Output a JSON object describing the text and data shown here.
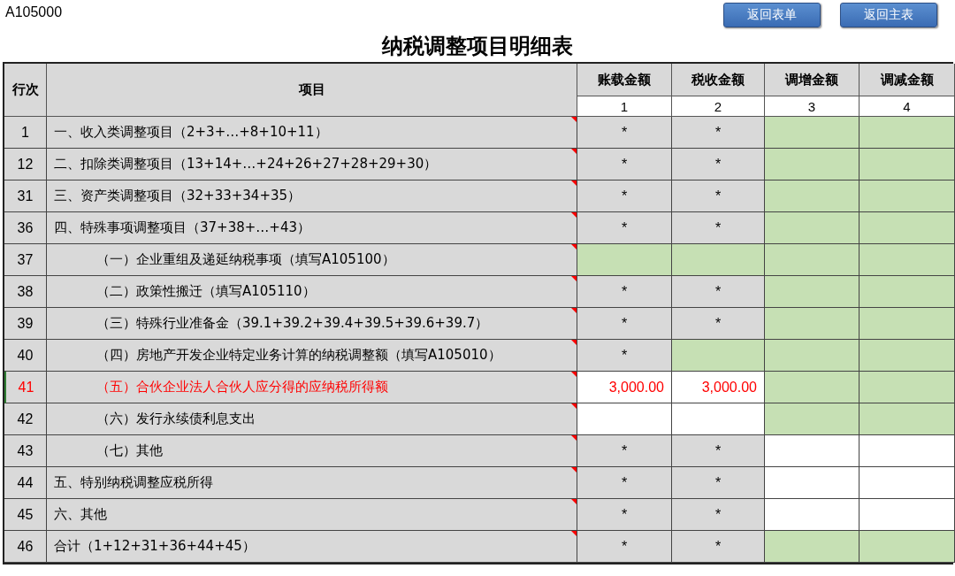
{
  "form_code": "A105000",
  "buttons": [
    {
      "label": "返回表单"
    },
    {
      "label": "返回主表"
    }
  ],
  "title": "纳税调整项目明细表",
  "columns": [
    {
      "label": "行次"
    },
    {
      "label": "项目"
    },
    {
      "label": "账载金额",
      "number": "1"
    },
    {
      "label": "税收金额",
      "number": "2"
    },
    {
      "label": "调增金额",
      "number": "3"
    },
    {
      "label": "调减金额",
      "number": "4"
    }
  ],
  "rows": [
    {
      "no": "1",
      "item": "一、收入类调整项目（2+3+…+8+10+11）",
      "highlighted": false,
      "cells": [
        {
          "kind": "locked",
          "text": "*"
        },
        {
          "kind": "locked",
          "text": "*"
        },
        {
          "kind": "input"
        },
        {
          "kind": "input"
        }
      ]
    },
    {
      "no": "12",
      "item": "二、扣除类调整项目（13+14+…+24+26+27+28+29+30）",
      "highlighted": false,
      "cells": [
        {
          "kind": "locked",
          "text": "*"
        },
        {
          "kind": "locked",
          "text": "*"
        },
        {
          "kind": "input"
        },
        {
          "kind": "input"
        }
      ]
    },
    {
      "no": "31",
      "item": "三、资产类调整项目（32+33+34+35）",
      "highlighted": false,
      "cells": [
        {
          "kind": "locked",
          "text": "*"
        },
        {
          "kind": "locked",
          "text": "*"
        },
        {
          "kind": "input"
        },
        {
          "kind": "input"
        }
      ]
    },
    {
      "no": "36",
      "item": "四、特殊事项调整项目（37+38+…+43）",
      "highlighted": false,
      "cells": [
        {
          "kind": "locked",
          "text": "*"
        },
        {
          "kind": "locked",
          "text": "*"
        },
        {
          "kind": "input"
        },
        {
          "kind": "input"
        }
      ],
      "children": [
        {
          "no": "37",
          "item": "（一）企业重组及递延纳税事项（填写A105100）",
          "highlighted": false,
          "cells": [
            {
              "kind": "input"
            },
            {
              "kind": "input"
            },
            {
              "kind": "input"
            },
            {
              "kind": "input"
            }
          ]
        },
        {
          "no": "38",
          "item": "（二）政策性搬迁（填写A105110）",
          "highlighted": false,
          "cells": [
            {
              "kind": "locked",
              "text": "*"
            },
            {
              "kind": "locked",
              "text": "*"
            },
            {
              "kind": "input"
            },
            {
              "kind": "input"
            }
          ]
        },
        {
          "no": "39",
          "item": "（三）特殊行业准备金（39.1+39.2+39.4+39.5+39.6+39.7）",
          "highlighted": false,
          "cells": [
            {
              "kind": "locked",
              "text": "*"
            },
            {
              "kind": "locked",
              "text": "*"
            },
            {
              "kind": "input"
            },
            {
              "kind": "input"
            }
          ]
        },
        {
          "no": "40",
          "item": "（四）房地产开发企业特定业务计算的纳税调整额（填写A105010）",
          "highlighted": false,
          "cells": [
            {
              "kind": "locked",
              "text": "*"
            },
            {
              "kind": "input"
            },
            {
              "kind": "input"
            },
            {
              "kind": "input"
            }
          ]
        },
        {
          "no": "41",
          "item": "（五）合伙企业法人合伙人应分得的应纳税所得额",
          "highlighted": true,
          "cells": [
            {
              "kind": "blank",
              "text": "3,000.00"
            },
            {
              "kind": "blank",
              "text": "3,000.00"
            },
            {
              "kind": "input"
            },
            {
              "kind": "input"
            }
          ]
        },
        {
          "no": "42",
          "item": "（六）发行永续债利息支出",
          "highlighted": false,
          "cells": [
            {
              "kind": "blank"
            },
            {
              "kind": "blank"
            },
            {
              "kind": "input"
            },
            {
              "kind": "input"
            }
          ]
        },
        {
          "no": "43",
          "item": "（七）其他",
          "highlighted": false,
          "cells": [
            {
              "kind": "locked",
              "text": "*"
            },
            {
              "kind": "locked",
              "text": "*"
            },
            {
              "kind": "blank"
            },
            {
              "kind": "blank"
            }
          ]
        }
      ]
    },
    {
      "no": "44",
      "item": "五、特别纳税调整应税所得",
      "highlighted": false,
      "cells": [
        {
          "kind": "locked",
          "text": "*"
        },
        {
          "kind": "locked",
          "text": "*"
        },
        {
          "kind": "blank"
        },
        {
          "kind": "blank"
        }
      ]
    },
    {
      "no": "45",
      "item": "六、其他",
      "highlighted": false,
      "cells": [
        {
          "kind": "locked",
          "text": "*"
        },
        {
          "kind": "locked",
          "text": "*"
        },
        {
          "kind": "blank"
        },
        {
          "kind": "blank"
        }
      ]
    },
    {
      "no": "46",
      "item": "合计（1+12+31+36+44+45）",
      "highlighted": false,
      "cells": [
        {
          "kind": "locked",
          "text": "*"
        },
        {
          "kind": "locked",
          "text": "*"
        },
        {
          "kind": "input"
        },
        {
          "kind": "input"
        }
      ]
    }
  ]
}
